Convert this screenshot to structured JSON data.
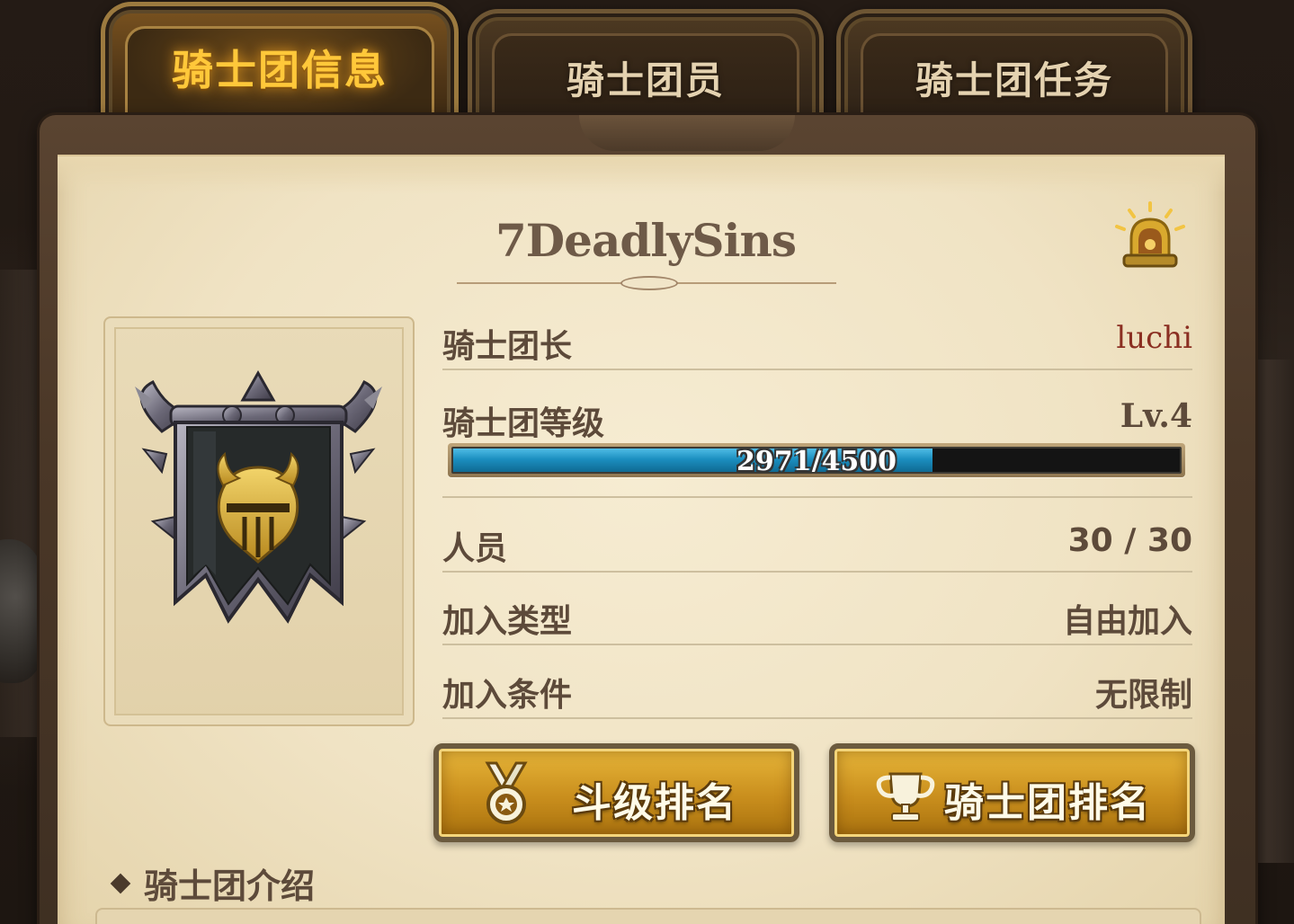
{
  "tabs": [
    {
      "label": "骑士团信息",
      "active": true
    },
    {
      "label": "骑士团员",
      "active": false
    },
    {
      "label": "骑士团任务",
      "active": false
    }
  ],
  "guild": {
    "name": "7DeadlySins"
  },
  "info": {
    "leader_label": "骑士团长",
    "leader_value": "luchi",
    "level_label": "骑士团等级",
    "level_value": "Lv.4",
    "exp_text": "2971/4500",
    "exp_current": 2971,
    "exp_max": 4500,
    "members_label": "人员",
    "members_value": "30 / 30",
    "join_type_label": "加入类型",
    "join_type_value": "自由加入",
    "join_condition_label": "加入条件",
    "join_condition_value": "无限制"
  },
  "buttons": {
    "rank_label": "斗级排名",
    "guild_rank_label": "骑士团排名"
  },
  "intro": {
    "title": "骑士团介绍"
  },
  "icons": {
    "bell": "alarm-bell-icon",
    "emblem": "guild-banner-emblem",
    "medal": "medal-icon",
    "trophy": "trophy-icon"
  },
  "colors": {
    "active_tab_text": "#ffc83a",
    "exp_fill": "#1c8fc0",
    "leader_name": "#8b2f22",
    "button_gold": "#c98e1d"
  }
}
